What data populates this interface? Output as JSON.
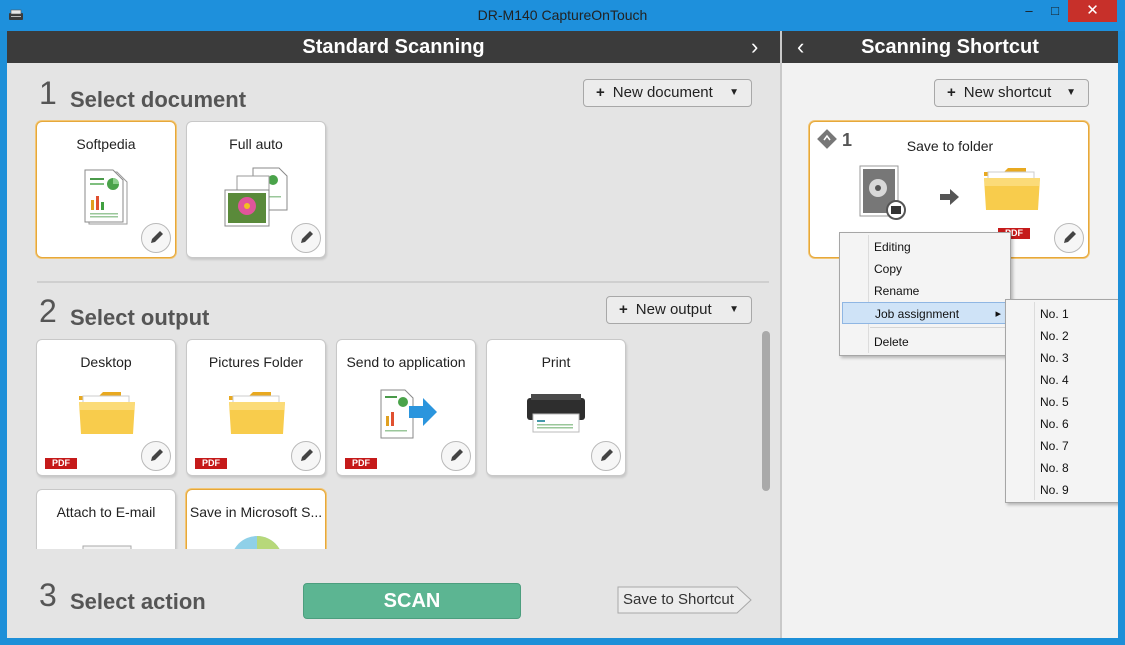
{
  "window": {
    "title": "DR-M140 CaptureOnTouch",
    "minimize_glyph": "–",
    "maximize_glyph": "□",
    "close_glyph": "✕"
  },
  "left_panel": {
    "header": "Standard Scanning",
    "header_chevron": "›",
    "section1": {
      "number": "1",
      "title": "Select document",
      "new_button": "New document"
    },
    "documents": [
      {
        "label": "Softpedia",
        "icon": "document-chart-icon"
      },
      {
        "label": "Full auto",
        "icon": "documents-photo-icon"
      }
    ],
    "section2": {
      "number": "2",
      "title": "Select output",
      "new_button": "New output"
    },
    "outputs": [
      {
        "label": "Desktop",
        "icon": "folder-icon",
        "badge": "PDF"
      },
      {
        "label": "Pictures Folder",
        "icon": "folder-icon",
        "badge": "PDF"
      },
      {
        "label": "Send to application",
        "icon": "send-document-icon",
        "badge": "PDF"
      },
      {
        "label": "Print",
        "icon": "printer-icon",
        "badge": ""
      },
      {
        "label": "Attach to E-mail",
        "icon": "email-icon",
        "badge": ""
      },
      {
        "label": "Save in Microsoft S...",
        "icon": "sharepoint-icon",
        "badge": ""
      }
    ],
    "section3": {
      "number": "3",
      "title": "Select action"
    },
    "scan_button": "SCAN",
    "save_shortcut_button": "Save to Shortcut"
  },
  "right_panel": {
    "header": "Scanning Shortcut",
    "header_chevron": "‹",
    "new_button": "New shortcut",
    "shortcut": {
      "number": "1",
      "label": "Save to folder",
      "badge": "PDF"
    }
  },
  "context_menu": {
    "items": [
      "Editing",
      "Copy",
      "Rename",
      "Job assignment",
      "Delete"
    ],
    "submenu_arrow": "▸",
    "highlighted": "Job assignment"
  },
  "submenu": {
    "items": [
      "No. 1",
      "No. 2",
      "No. 3",
      "No. 4",
      "No. 5",
      "No. 6",
      "No. 7",
      "No. 8",
      "No. 9"
    ]
  },
  "colors": {
    "titlebar": "#1e90dc",
    "header": "#3b3b3b",
    "scan": "#5cb592",
    "selected_border": "#e6a83a",
    "pdf_badge": "#c51a1a"
  }
}
